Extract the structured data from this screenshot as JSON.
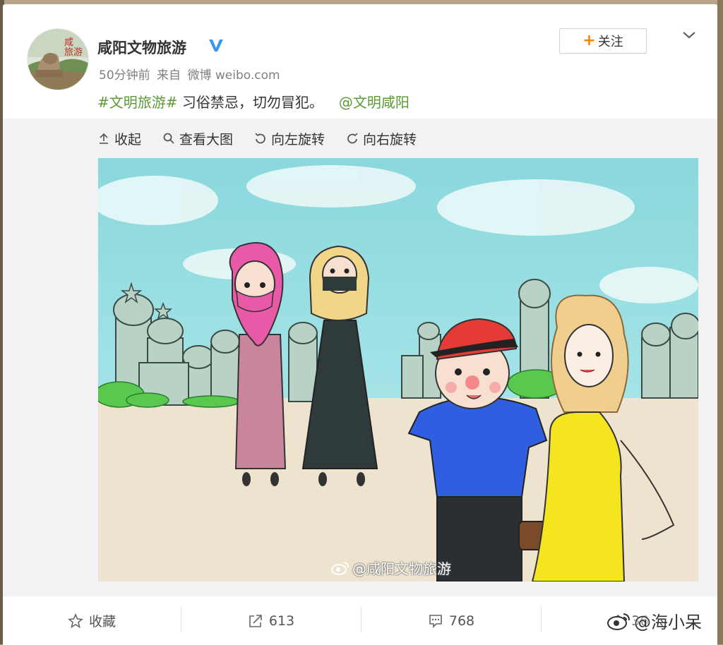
{
  "post": {
    "username": "咸阳文物旅游",
    "time": "50分钟前",
    "source_label": "来自",
    "source": "微博 weibo.com",
    "hashtag": "#文明旅游#",
    "body": " 习俗禁忌，切勿冒犯。",
    "mention": "@文明咸阳",
    "avatar_text_1": "咸",
    "avatar_text_2": "旅游"
  },
  "follow": {
    "label": "关注"
  },
  "toolbar": {
    "collapse": "收起",
    "view_large": "查看大图",
    "rotate_left": "向左旋转",
    "rotate_right": "向右旋转"
  },
  "image": {
    "watermark": "@咸阳文物旅游"
  },
  "actions": {
    "favorite": "收藏",
    "repost_count": "613",
    "comment_count": "768",
    "like_count": "36"
  },
  "screen_watermark": "@海小呆",
  "colors": {
    "accent_green": "#5b9a36",
    "follow_plus": "#ff8200",
    "verified_blue": "#3a96f0"
  }
}
